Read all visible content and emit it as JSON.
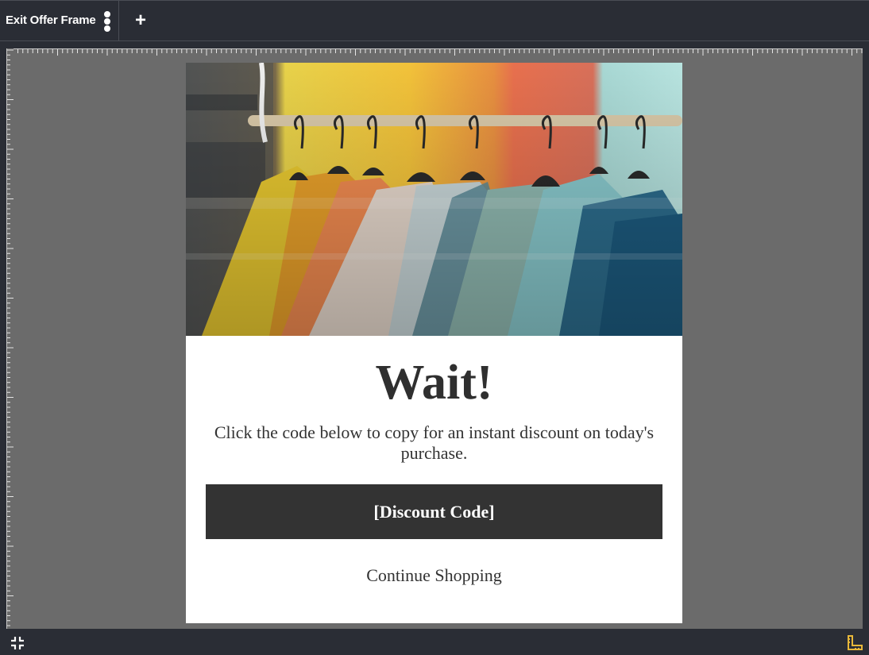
{
  "tabs": [
    {
      "label": "Exit Offer Frame",
      "menu_icon": "kebab-menu-icon"
    }
  ],
  "toolbar": {
    "add_tab_label": "+",
    "add_tab_icon": "plus-icon"
  },
  "popup": {
    "headline": "Wait!",
    "message": "Click the code below to copy for an instant discount on today's purchase.",
    "discount_button": "[Discount Code]",
    "continue_link": "Continue Shopping"
  },
  "bottombar": {
    "left_icon": "collapse-icon",
    "right_icon": "ruler-icon",
    "accent_color": "#e8b83a"
  },
  "colors": {
    "chrome": "#2a2d35",
    "workspace": "#6b6b6b",
    "button_bg": "#333333"
  }
}
